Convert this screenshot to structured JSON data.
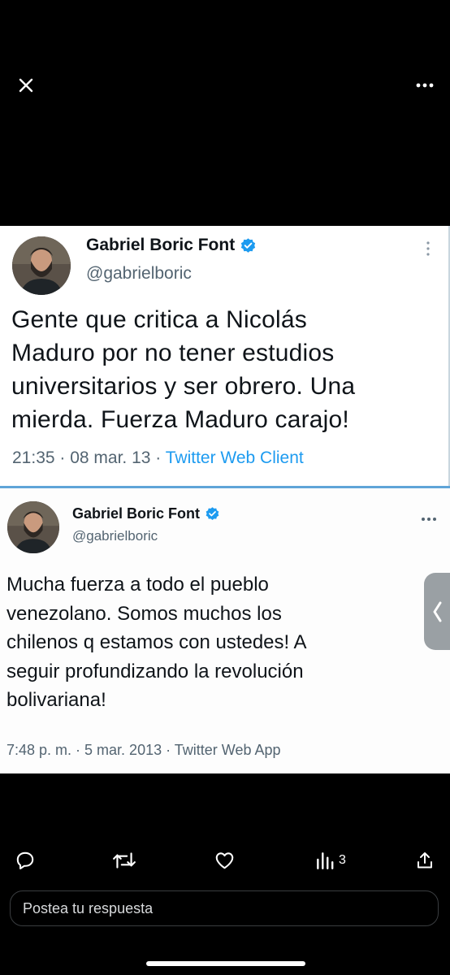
{
  "tweets": [
    {
      "name": "Gabriel Boric Font",
      "handle": "@gabrielboric",
      "text": "Gente que critica a Nicolás\nMaduro por no tener estudios\nuniversitarios y ser obrero. Una\nmierda. Fuerza Maduro carajo!",
      "time": "21:35 · 08 mar. 13 · ",
      "source": "Twitter Web Client"
    },
    {
      "name": "Gabriel Boric Font",
      "handle": "@gabrielboric",
      "text": "Mucha fuerza a todo el pueblo\nvenezolano. Somos muchos los\nchilenos q estamos con ustedes! A\nseguir profundizando la revolución\nbolivariana!",
      "time": "7:48 p. m. · 5 mar. 2013 · ",
      "source": "Twitter Web App"
    }
  ],
  "actions": {
    "views_count": "3"
  },
  "reply": {
    "placeholder": "Postea tu respuesta"
  },
  "icons": {
    "close": "close-icon",
    "more": "more-icon",
    "verified": "verified-badge-icon",
    "reply": "reply-icon",
    "retweet": "retweet-icon",
    "like": "heart-icon",
    "views": "views-icon",
    "share": "share-icon",
    "side": "chevron-left-icon"
  },
  "colors": {
    "link": "#1d9bf0",
    "verified": "#1d9bf0",
    "divider": "#5fa5d8",
    "background": "#000000"
  }
}
